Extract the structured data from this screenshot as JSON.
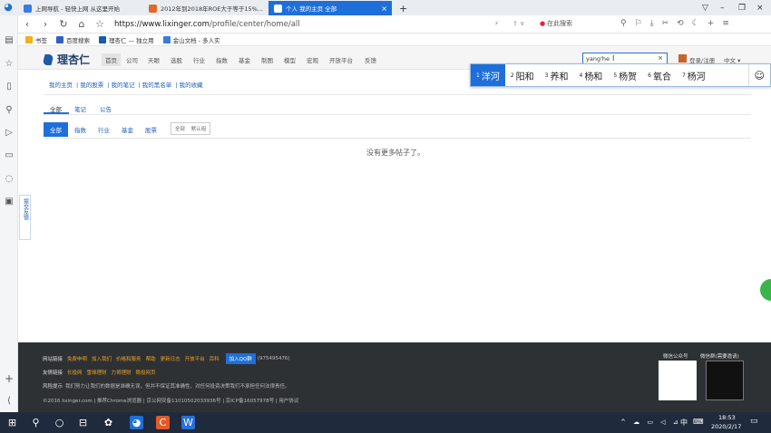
{
  "browser": {
    "tabs": [
      {
        "label": "上网导航 - 轻快上网 从这里开始",
        "color": "#3a7be0"
      },
      {
        "label": "2012年到2018年ROE大于等于15%...",
        "color": "#e06a2a"
      },
      {
        "label": "个人 我的主页 全部",
        "color": "#ffffff",
        "active": true
      }
    ],
    "url_prefix": "https://",
    "url_host": "www.lixinger.com",
    "url_path": "/profile/center/home/all",
    "search_engine_label": "在此搜索",
    "bookmarks": [
      {
        "label": "书签",
        "color": "#f0b020"
      },
      {
        "label": "百度搜索",
        "color": "#3060c0"
      },
      {
        "label": "理杏仁 — 独立用",
        "color": "#1d5aa8"
      },
      {
        "label": "金山文档 - 多人实",
        "color": "#3a7be0"
      }
    ]
  },
  "site": {
    "logo_text": "理杏仁",
    "nav": [
      "首页",
      "公司",
      "天眼",
      "选股",
      "行业",
      "指数",
      "基金",
      "制图",
      "模型",
      "宏观",
      "开放平台",
      "反馈"
    ],
    "search_value": "yang'he",
    "login_label": "登录/注册",
    "lang_label": "中文"
  },
  "ime": {
    "candidates": [
      {
        "n": "1",
        "w": "洋河"
      },
      {
        "n": "2",
        "w": "阳和"
      },
      {
        "n": "3",
        "w": "养和"
      },
      {
        "n": "4",
        "w": "杨和"
      },
      {
        "n": "5",
        "w": "杨贺"
      },
      {
        "n": "6",
        "w": "氧合"
      },
      {
        "n": "7",
        "w": "杨河"
      }
    ],
    "emoji_icon": "smile-icon"
  },
  "profile": {
    "links": [
      "我的主页",
      "我的股票",
      "我的笔记",
      "我的黑名单",
      "我的收藏"
    ],
    "tabs": [
      "全部",
      "笔记",
      "公告"
    ],
    "filters": [
      "全部",
      "指数",
      "行业",
      "基金",
      "股票"
    ],
    "sort_label": "全部",
    "sort_default": "默认组",
    "empty_message": "没有更多帖子了。"
  },
  "feedback": {
    "label": "提交反馈"
  },
  "footer": {
    "links_label": "网站链接",
    "links": [
      "免费申明",
      "加入我们",
      "价格和服务",
      "帮助",
      "更新日志",
      "开放平台",
      "百科"
    ],
    "qq_label": "加入QQ群",
    "qq_number": "(975495476)",
    "friends_label": "友情链接",
    "friends": [
      "长投网",
      "雪球理财",
      "力哥理财",
      "稳投网页"
    ],
    "risk_label": "风险提示",
    "risk_text": "我们努力让我们的数据是准确无误，但并不保证其准确性，对任何投资决策我们不承担任何法律责任。",
    "copyright": "©2016 lixinger.com | 推荐Chrome浏览器 | 京公网安备11010502033936号 | 京ICP备16057978号 | 用户协议",
    "wechat_label": "微信公众号",
    "wechat_group_label": "微信群(需要邀请)"
  },
  "taskbar": {
    "time": "18:53",
    "date": "2020/2/17",
    "input_mode": "中"
  }
}
